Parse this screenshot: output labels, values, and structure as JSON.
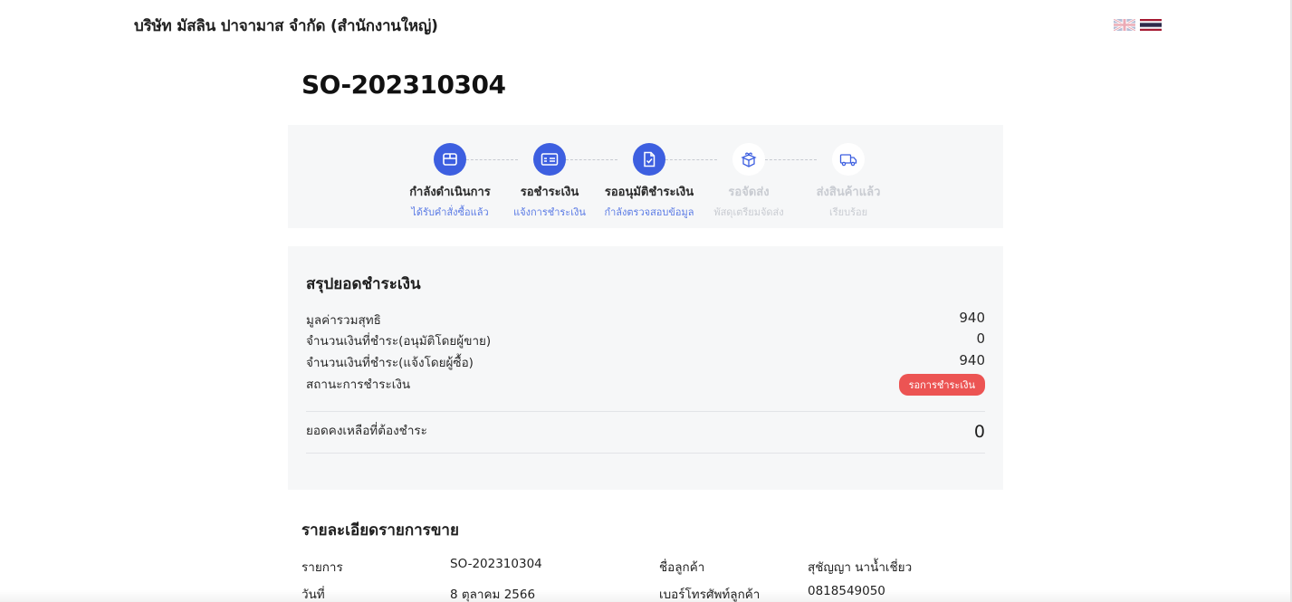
{
  "header": {
    "company_name": "บริษัท มัสลิน ปาจามาส จำกัด (สำนักงานใหญ่)",
    "languages": [
      {
        "code": "en",
        "icon": "uk-flag-icon",
        "active": false
      },
      {
        "code": "th",
        "icon": "thai-flag-icon",
        "active": true
      }
    ]
  },
  "order": {
    "number": "SO-202310304"
  },
  "tracker": {
    "steps": [
      {
        "title": "กำลังดำเนินการ",
        "subtitle": "ได้รับคำสั่งซื้อแล้ว",
        "status": "done",
        "icon": "package-icon"
      },
      {
        "title": "รอชำระเงิน",
        "subtitle": "แจ้งการชำระเงิน",
        "status": "done",
        "icon": "payment-card-icon"
      },
      {
        "title": "รออนุมัติชำระเงิน",
        "subtitle": "กำลังตรวจสอบข้อมูล",
        "status": "done",
        "icon": "document-check-icon"
      },
      {
        "title": "รอจัดส่ง",
        "subtitle": "พัสดุเตรียมจัดส่ง",
        "status": "pending",
        "icon": "gift-box-icon"
      },
      {
        "title": "ส่งสินค้าแล้ว",
        "subtitle": "เรียบร้อย",
        "status": "pending",
        "icon": "delivery-truck-icon"
      }
    ],
    "colors": {
      "done": "#3d5fe0",
      "pending": "#c9ccd2"
    }
  },
  "payment_summary": {
    "title": "สรุปยอดชำระเงิน",
    "rows": [
      {
        "label": "มูลค่ารวมสุทธิ",
        "value": "940"
      },
      {
        "label": "จำนวนเงินที่ชำระ(อนุมัติโดยผู้ขาย)",
        "value": "0"
      },
      {
        "label": "จำนวนเงินที่ชำระ(แจ้งโดยผู้ซื้อ)",
        "value": "940"
      }
    ],
    "status_label": "สถานะการชำระเงิน",
    "status_badge": "รอการชำระเงิน",
    "status_color": "#ec5453",
    "balance_label": "ยอดคงเหลือที่ต้องชำระ",
    "balance_value": "0"
  },
  "sale_details": {
    "title": "รายละเอียดรายการขาย",
    "rows": [
      {
        "label1": "รายการ",
        "value1": "SO-202310304",
        "label2": "ชื่อลูกค้า",
        "value2": "สุชัญญา นาน้ำเชี่ยว"
      },
      {
        "label1": "วันที่",
        "value1": "8 ตุลาคม 2566",
        "label2": "เบอร์โทรศัพท์ลูกค้า",
        "value2": "0818549050"
      }
    ]
  }
}
